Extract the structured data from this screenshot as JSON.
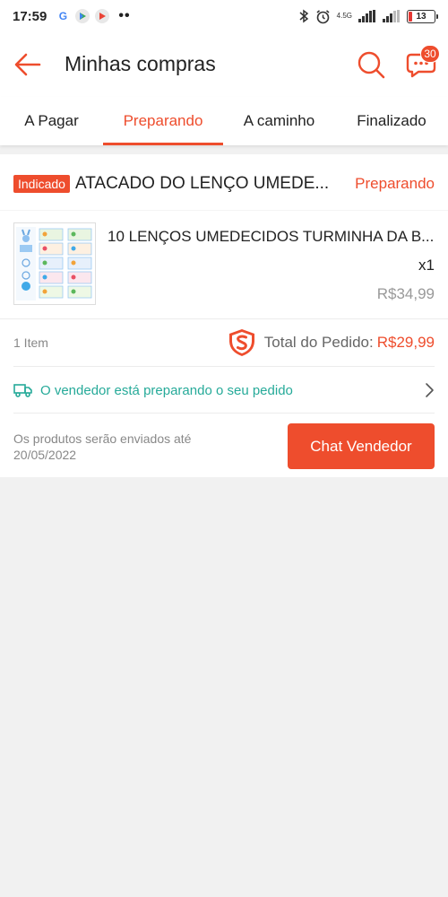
{
  "status_bar": {
    "time": "17:59",
    "network_label": "4.5G",
    "battery": "13"
  },
  "header": {
    "title": "Minhas compras",
    "chat_badge": "30"
  },
  "tabs": [
    {
      "label": "A Pagar",
      "active": false
    },
    {
      "label": "Preparando",
      "active": true
    },
    {
      "label": "A caminho",
      "active": false
    },
    {
      "label": "Finalizado",
      "active": false
    }
  ],
  "order": {
    "badge": "Indicado",
    "shop_name": "ATACADO DO LENÇO UMEDE...",
    "status": "Preparando",
    "product_name": "10 LENÇOS UMEDECIDOS TURMINHA DA B...",
    "quantity": "x1",
    "price": "R$34,99",
    "item_count": "1 Item",
    "total_label": "Total do Pedido:",
    "total_value": "R$29,99",
    "shipping_status": "O vendedor está preparando o seu pedido",
    "ship_note": "Os produtos serão enviados até 20/05/2022",
    "chat_button": "Chat Vendedor"
  },
  "colors": {
    "accent": "#ee4d2d",
    "teal": "#26aa99",
    "background": "#f1f1f1"
  },
  "icons": [
    "google-icon",
    "play-store-icon",
    "play-icon",
    "bluetooth-icon",
    "alarm-icon",
    "signal-icon",
    "battery-icon",
    "back-arrow-icon",
    "search-icon",
    "chat-icon",
    "shield-icon",
    "truck-icon",
    "chevron-right-icon"
  ]
}
